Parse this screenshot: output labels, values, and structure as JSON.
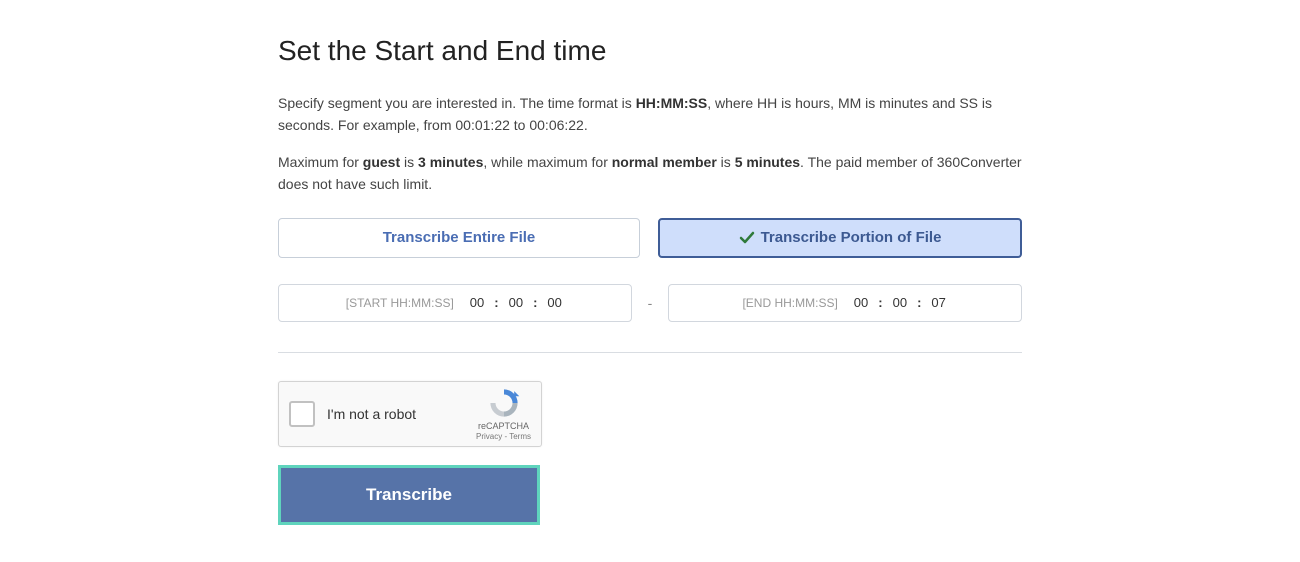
{
  "heading": "Set the Start and End time",
  "desc1_pre": "Specify segment you are interested in. The time format is ",
  "desc1_fmt": "HH:MM:SS",
  "desc1_post": ", where HH is hours, MM is minutes and SS is seconds. For example, from 00:01:22 to 00:06:22.",
  "desc2_a": "Maximum for ",
  "desc2_guest": "guest",
  "desc2_b": " is ",
  "desc2_guest_limit": "3 minutes",
  "desc2_c": ", while maximum for ",
  "desc2_member": "normal member",
  "desc2_d": " is ",
  "desc2_member_limit": "5 minutes",
  "desc2_e": ". The paid member of 360Converter does not have such limit.",
  "options": {
    "entire": "Transcribe Entire File",
    "portion": "Transcribe Portion of File"
  },
  "time": {
    "start_label": "[START HH:MM:SS]",
    "start_hh": "00",
    "start_mm": "00",
    "start_ss": "00",
    "dash": "-",
    "end_label": "[END HH:MM:SS]",
    "end_hh": "00",
    "end_mm": "00",
    "end_ss": "07",
    "colon": ":"
  },
  "captcha": {
    "text": "I'm not a robot",
    "brand": "reCAPTCHA",
    "links": "Privacy - Terms"
  },
  "submit": "Transcribe"
}
